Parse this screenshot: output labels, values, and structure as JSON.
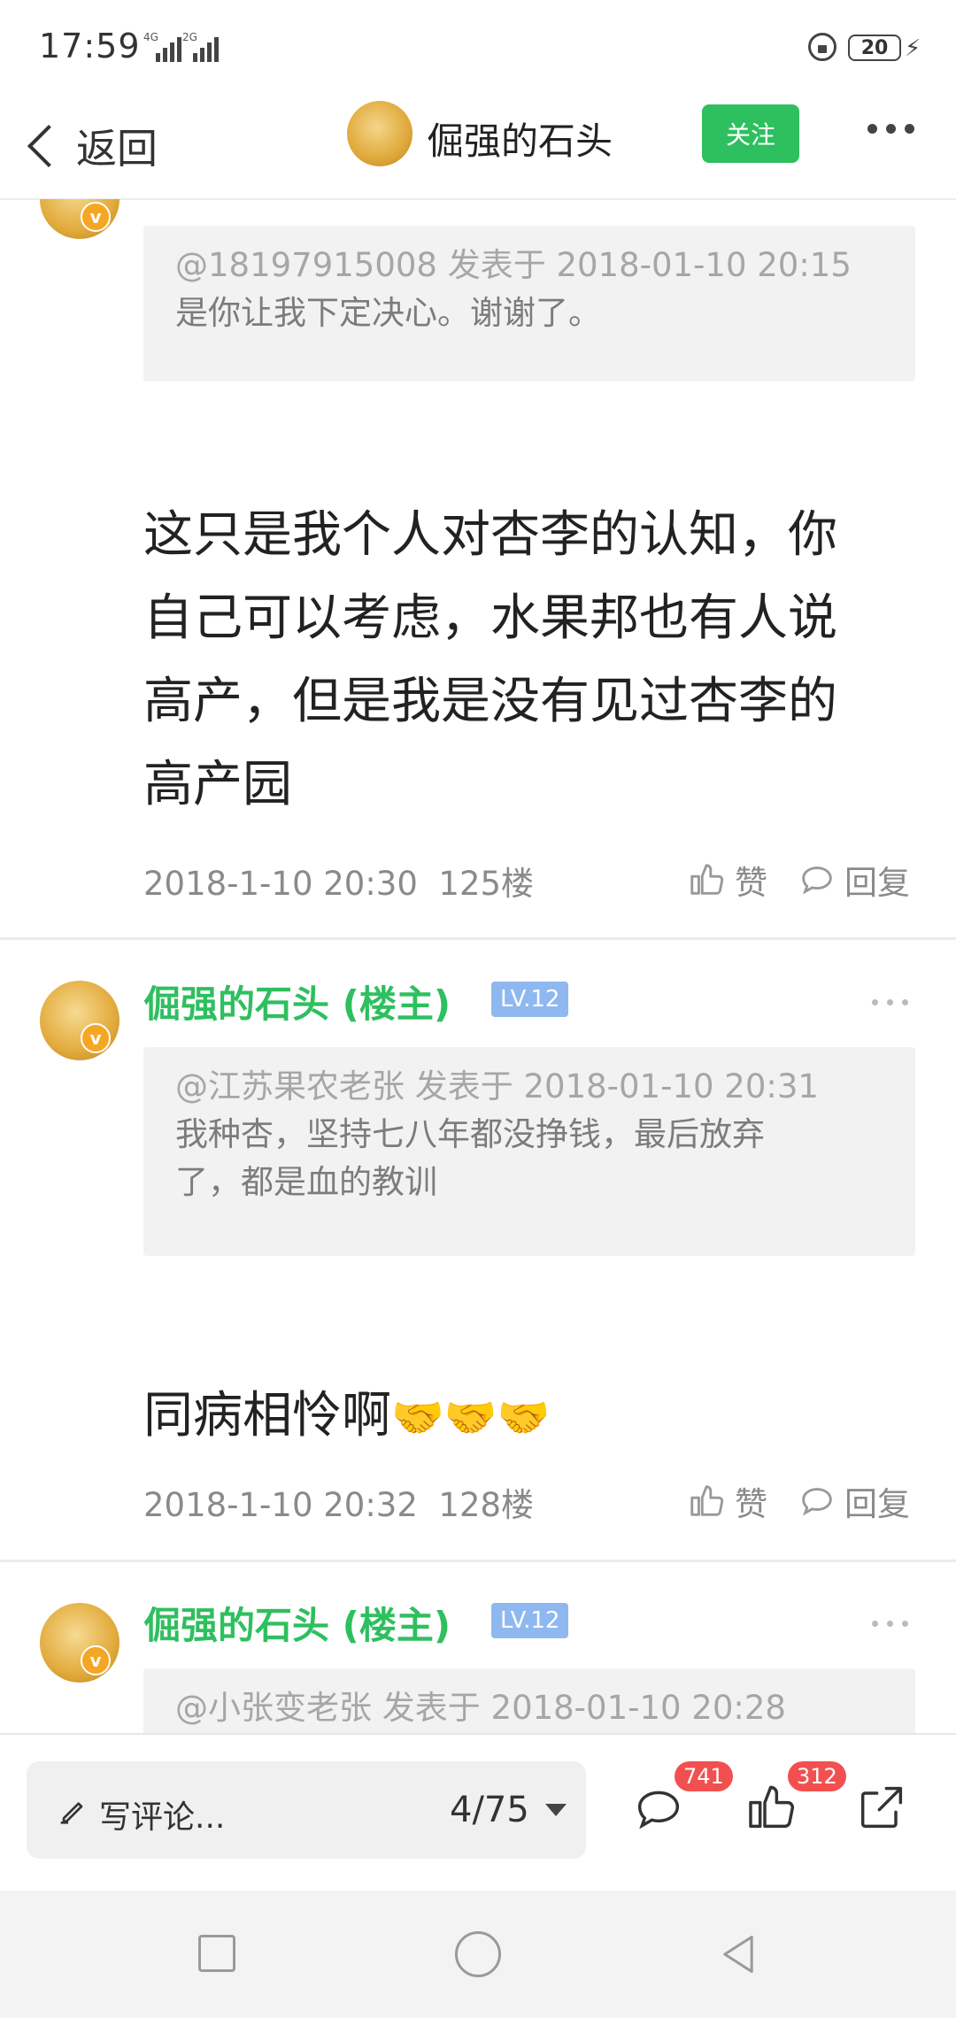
{
  "status_bar": {
    "time": "17:59",
    "net1": "4G",
    "net2": "2G",
    "battery": "20"
  },
  "header": {
    "back_label": "返回",
    "title": "倔强的石头",
    "follow_label": "关注"
  },
  "posts": [
    {
      "quote_meta": "@18197915008 发表于 2018-01-10 20:15",
      "quote_text": "是你让我下定决心。谢谢了。",
      "body_lines": [
        "这只是我个人对杏李的认知，你",
        "自己可以考虑，水果邦也有人说",
        "高产，但是我是没有见过杏李的",
        "高产园"
      ],
      "date": "2018-1-10 20:30",
      "floor": "125楼",
      "like_label": "赞",
      "reply_label": "回复"
    },
    {
      "author": "倔强的石头 (楼主)",
      "level": "LV.12",
      "quote_meta": "@江苏果农老张 发表于 2018-01-10 20:31",
      "quote_lines": [
        "我种杏，坚持七八年都没挣钱，最后放弃",
        "了，都是血的教训"
      ],
      "body_text": "同病相怜啊",
      "emojis": "🤝🤝🤝",
      "date": "2018-1-10 20:32",
      "floor": "128楼",
      "like_label": "赞",
      "reply_label": "回复"
    },
    {
      "author": "倔强的石头 (楼主)",
      "level": "LV.12",
      "quote_meta": "@小张变老张 发表于 2018-01-10 20:28"
    }
  ],
  "bottom_bar": {
    "comment_placeholder": "写评论...",
    "page_indicator": "4/75",
    "comment_count": "741",
    "like_count": "312"
  },
  "colors": {
    "accent_green": "#2ebf5f",
    "badge_red": "#f25050",
    "level_blue": "#8fb8f0"
  }
}
